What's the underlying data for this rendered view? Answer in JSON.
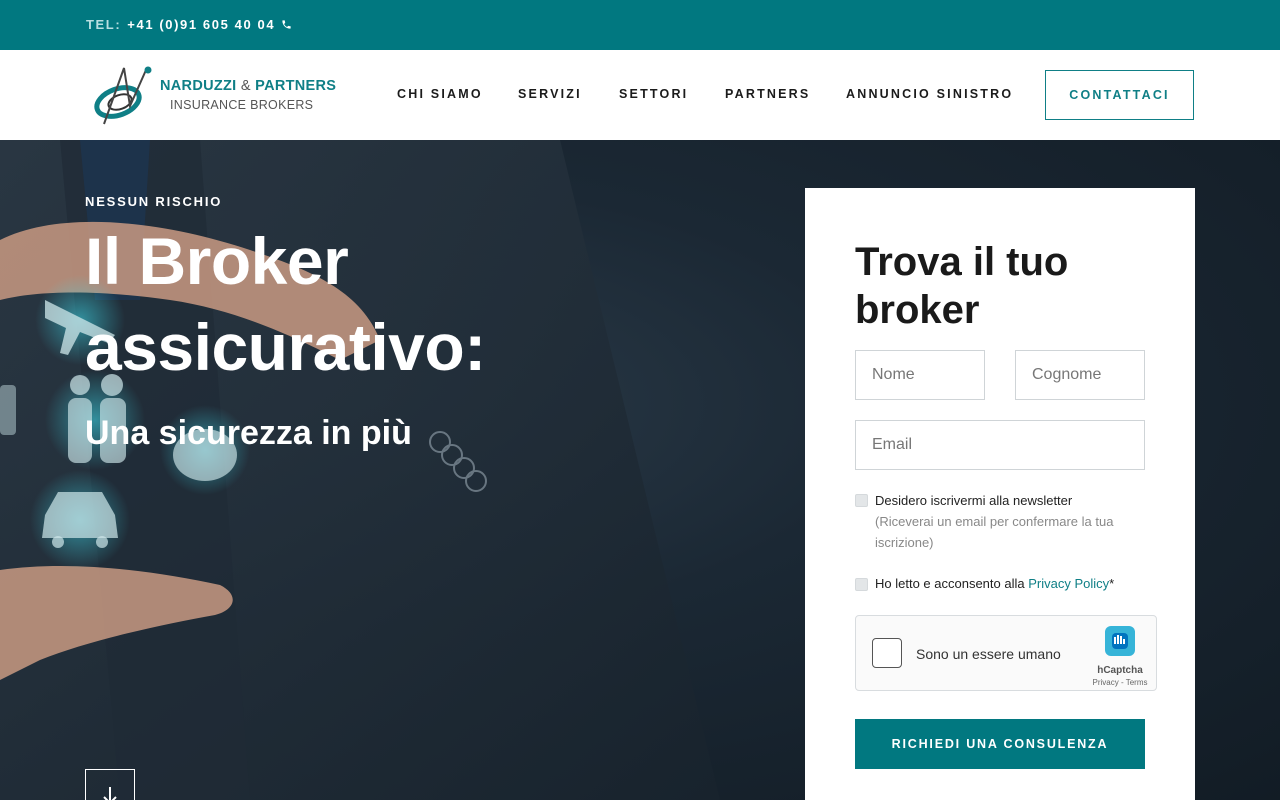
{
  "topbar": {
    "tel_label": "TEL:",
    "tel_number": "+41 (0)91 605 40 04"
  },
  "logo": {
    "name_a": "NARDUZZI",
    "name_amp": "&",
    "name_b": "PARTNERS",
    "sub": "INSURANCE BROKERS"
  },
  "nav": {
    "items": [
      {
        "label": "CHI SIAMO"
      },
      {
        "label": "SERVIZI"
      },
      {
        "label": "SETTORI"
      },
      {
        "label": "PARTNERS"
      },
      {
        "label": "ANNUNCIO SINISTRO"
      }
    ],
    "cta": "CONTATTACI"
  },
  "hero": {
    "eyebrow": "NESSUN RISCHIO",
    "title_line1": "Il Broker",
    "title_line2": "assicurativo:",
    "subtitle": "Una sicurezza in più"
  },
  "form": {
    "title": "Trova il tuo broker",
    "nome_placeholder": "Nome",
    "cognome_placeholder": "Cognome",
    "email_placeholder": "Email",
    "newsletter_label": "Desidero iscrivermi alla newsletter",
    "newsletter_note": "(Riceverai un email per confermare la tua iscrizione)",
    "privacy_prefix": "Ho letto e acconsento alla",
    "privacy_link": "Privacy Policy",
    "privacy_suffix": "*",
    "captcha_label": "Sono un essere umano",
    "captcha_brand": "hCaptcha",
    "captcha_terms": "Privacy - Terms",
    "submit": "RICHIEDI UNA CONSULENZA"
  },
  "colors": {
    "brand": "#017880",
    "accent": "#0f7f86",
    "text_dark": "#1a1a1a"
  },
  "icons": [
    "phone-icon",
    "arrow-down-icon",
    "hcaptcha-logo-icon"
  ]
}
